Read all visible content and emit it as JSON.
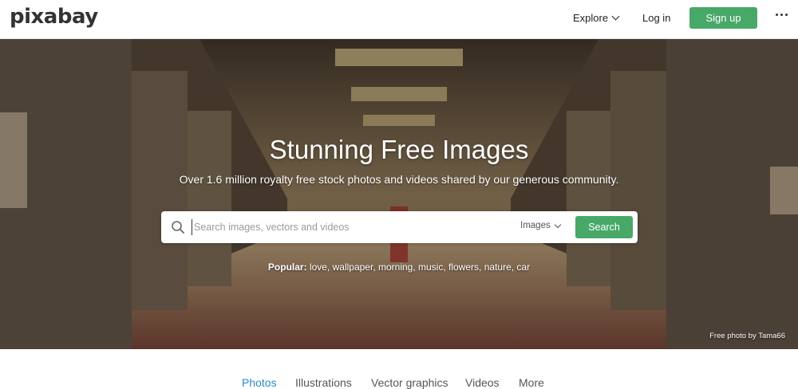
{
  "header": {
    "logo": "pixabay",
    "explore_label": "Explore",
    "login_label": "Log in",
    "signup_label": "Sign up",
    "more_icon": "more-dots-icon"
  },
  "hero": {
    "title": "Stunning Free Images",
    "subtitle": "Over 1.6 million royalty free stock photos and videos shared by our generous community.",
    "search": {
      "placeholder": "Search images, vectors and videos",
      "value": "",
      "type_selected": "Images",
      "button_label": "Search"
    },
    "popular": {
      "label": "Popular:",
      "terms": [
        "love",
        "wallpaper",
        "morning",
        "music",
        "flowers",
        "nature",
        "car"
      ]
    },
    "credit": "Free photo by Tama66"
  },
  "tabs": [
    {
      "label": "Photos",
      "active": true
    },
    {
      "label": "Illustrations",
      "active": false
    },
    {
      "label": "Vector graphics",
      "active": false
    },
    {
      "label": "Videos",
      "active": false
    },
    {
      "label": "More",
      "active": false
    }
  ],
  "colors": {
    "accent_green": "#48a868",
    "active_tab_blue": "#2b8ac6"
  }
}
